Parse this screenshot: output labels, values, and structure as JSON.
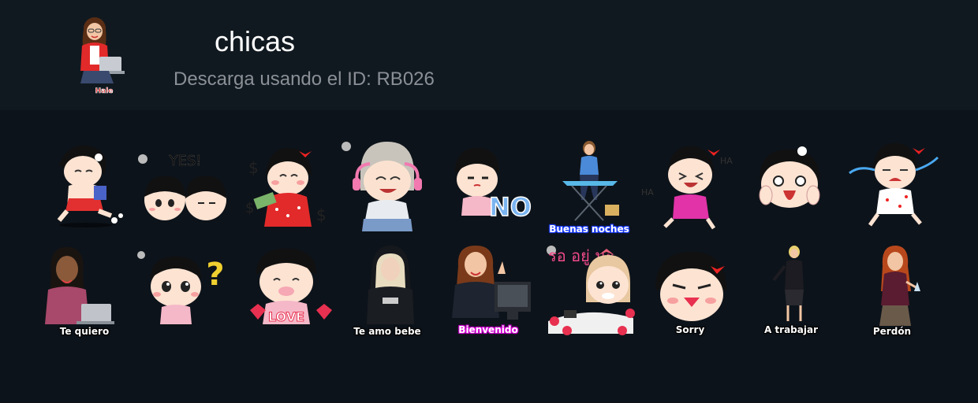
{
  "pack": {
    "title": "chicas",
    "subtitle": "Descarga usando el ID: RB026",
    "icon_caption": "Hale",
    "icon_name": "girl-with-laptop-icon"
  },
  "stickers": [
    {
      "name": "sticker-girl-running",
      "caption": ""
    },
    {
      "name": "sticker-two-babies-yes",
      "caption": ""
    },
    {
      "name": "sticker-girl-money",
      "caption": ""
    },
    {
      "name": "sticker-girl-headphones",
      "caption": ""
    },
    {
      "name": "sticker-baby-no",
      "caption": ""
    },
    {
      "name": "sticker-woman-ironing",
      "caption": "Buenas noches"
    },
    {
      "name": "sticker-girl-laughing",
      "caption": ""
    },
    {
      "name": "sticker-girl-shocked",
      "caption": ""
    },
    {
      "name": "sticker-girl-crying",
      "caption": ""
    },
    {
      "name": "sticker-woman-laptop",
      "caption": "Te quiero"
    },
    {
      "name": "sticker-baby-question",
      "caption": ""
    },
    {
      "name": "sticker-baby-love",
      "caption": ""
    },
    {
      "name": "sticker-woman-hoodie",
      "caption": "Te amo bebe"
    },
    {
      "name": "sticker-woman-computer",
      "caption": "Bienvenido"
    },
    {
      "name": "sticker-girl-flowers",
      "caption": ""
    },
    {
      "name": "sticker-girl-sorry",
      "caption": "Sorry"
    },
    {
      "name": "sticker-businesswoman",
      "caption": "A trabajar"
    },
    {
      "name": "sticker-redhead-woman",
      "caption": "Perdón"
    }
  ],
  "texts": {
    "no_label": "NO",
    "love_label": "LOVE",
    "question_mark": "?",
    "yes_label": "YES!",
    "thai_text": "รอ อยู่ นะ"
  },
  "colors": {
    "background": "#0d131a",
    "header": "#111920",
    "title": "#ffffff",
    "subtitle": "#8a9096"
  }
}
